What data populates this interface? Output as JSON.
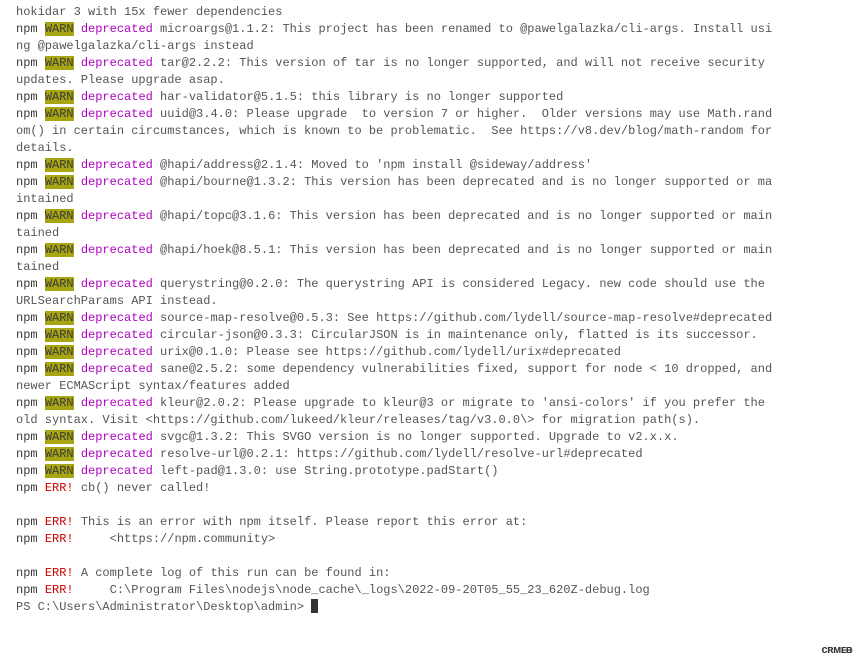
{
  "lines": [
    {
      "type": "cont",
      "text": "hokidar 3 with 15x fewer dependencies"
    },
    {
      "type": "warn",
      "text": "microargs@1.1.2: This project has been renamed to @pawelgalazka/cli-args. Install using @pawelgalazka/cli-args instead"
    },
    {
      "type": "warn",
      "text": "tar@2.2.2: This version of tar is no longer supported, and will not receive security updates. Please upgrade asap."
    },
    {
      "type": "warn",
      "text": "har-validator@5.1.5: this library is no longer supported"
    },
    {
      "type": "warn",
      "text": "uuid@3.4.0: Please upgrade  to version 7 or higher.  Older versions may use Math.random() in certain circumstances, which is known to be problematic.  See https://v8.dev/blog/math-random for details."
    },
    {
      "type": "warn",
      "text": "@hapi/address@2.1.4: Moved to 'npm install @sideway/address'"
    },
    {
      "type": "warn",
      "text": "@hapi/bourne@1.3.2: This version has been deprecated and is no longer supported or maintained"
    },
    {
      "type": "warn",
      "text": "@hapi/topc@3.1.6: This version has been deprecated and is no longer supported or maintained"
    },
    {
      "type": "warn",
      "text": "@hapi/hoek@8.5.1: This version has been deprecated and is no longer supported or maintained"
    },
    {
      "type": "warn",
      "text": "querystring@0.2.0: The querystring API is considered Legacy. new code should use the URLSearchParams API instead."
    },
    {
      "type": "warn",
      "text": "source-map-resolve@0.5.3: See https://github.com/lydell/source-map-resolve#deprecated"
    },
    {
      "type": "warn",
      "text": "circular-json@0.3.3: CircularJSON is in maintenance only, flatted is its successor."
    },
    {
      "type": "warn",
      "text": "urix@0.1.0: Please see https://github.com/lydell/urix#deprecated"
    },
    {
      "type": "warn",
      "text": "sane@2.5.2: some dependency vulnerabilities fixed, support for node < 10 dropped, and newer ECMAScript syntax/features added"
    },
    {
      "type": "warn",
      "text": "kleur@2.0.2: Please upgrade to kleur@3 or migrate to 'ansi-colors' if you prefer the old syntax. Visit <https://github.com/lukeed/kleur/releases/tag/v3.0.0\\> for migration path(s)."
    },
    {
      "type": "warn",
      "text": "svgc@1.3.2: This SVGO version is no longer supported. Upgrade to v2.x.x."
    },
    {
      "type": "warn",
      "text": "resolve-url@0.2.1: https://github.com/lydell/resolve-url#deprecated"
    },
    {
      "type": "warn",
      "text": "left-pad@1.3.0: use String.prototype.padStart()"
    },
    {
      "type": "err",
      "text": "cb() never called!"
    },
    {
      "type": "blank"
    },
    {
      "type": "err",
      "text": "This is an error with npm itself. Please report this error at:"
    },
    {
      "type": "err",
      "text": "    <https://npm.community>"
    },
    {
      "type": "blank"
    },
    {
      "type": "err",
      "text": "A complete log of this run can be found in:"
    },
    {
      "type": "err",
      "text": "    C:\\Program Files\\nodejs\\node_cache\\_logs\\2022-09-20T05_55_23_620Z-debug.log"
    }
  ],
  "labels": {
    "npm": "npm",
    "warn": "WARN",
    "deprecated": "deprecated",
    "err": "ERR!"
  },
  "prompt": "PS C:\\Users\\Administrator\\Desktop\\admin> ",
  "watermark": "ᴄʀᴍᴇᴃ"
}
